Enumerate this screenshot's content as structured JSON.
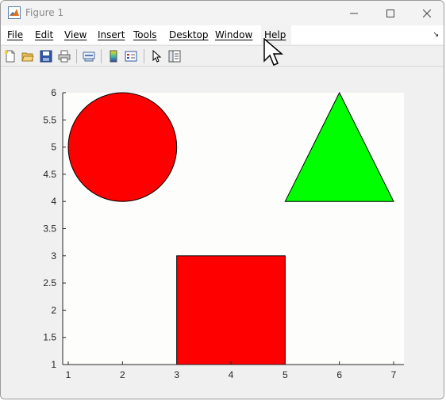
{
  "window": {
    "title": "Figure 1",
    "controls": [
      "minimize",
      "maximize",
      "close"
    ]
  },
  "menu": {
    "items": [
      "File",
      "Edit",
      "View",
      "Insert",
      "Tools",
      "Desktop",
      "Window",
      "Help"
    ],
    "hovered": "Help"
  },
  "toolbar": {
    "icons": [
      "new-figure-icon",
      "open-file-icon",
      "save-icon",
      "print-icon",
      "link-plot-icon",
      "insert-colorbar-icon",
      "insert-legend-icon",
      "edit-plot-icon",
      "property-inspector-icon"
    ]
  },
  "chart_data": {
    "type": "shapes",
    "xlim": [
      1,
      7
    ],
    "ylim": [
      1,
      6
    ],
    "xticks": [
      1,
      2,
      3,
      4,
      5,
      6,
      7
    ],
    "yticks": [
      1,
      1.5,
      2,
      2.5,
      3,
      3.5,
      4,
      4.5,
      5,
      5.5,
      6
    ],
    "xtick_labels": [
      "1",
      "2",
      "3",
      "4",
      "5",
      "6",
      "7"
    ],
    "ytick_labels": [
      "1",
      "1.5",
      "2",
      "2.5",
      "3",
      "3.5",
      "4",
      "4.5",
      "5",
      "5.5",
      "6"
    ],
    "grid": false,
    "shapes": [
      {
        "kind": "circle",
        "center": [
          2,
          5
        ],
        "radius": 1,
        "fill": "#ff0000"
      },
      {
        "kind": "triangle",
        "vertices": [
          [
            5,
            4
          ],
          [
            7,
            4
          ],
          [
            6,
            6
          ]
        ],
        "fill": "#00ff00"
      },
      {
        "kind": "rectangle",
        "x": [
          3,
          5
        ],
        "y": [
          1,
          3
        ],
        "fill": "#ff0000"
      }
    ],
    "background": "#fdfdfb"
  }
}
